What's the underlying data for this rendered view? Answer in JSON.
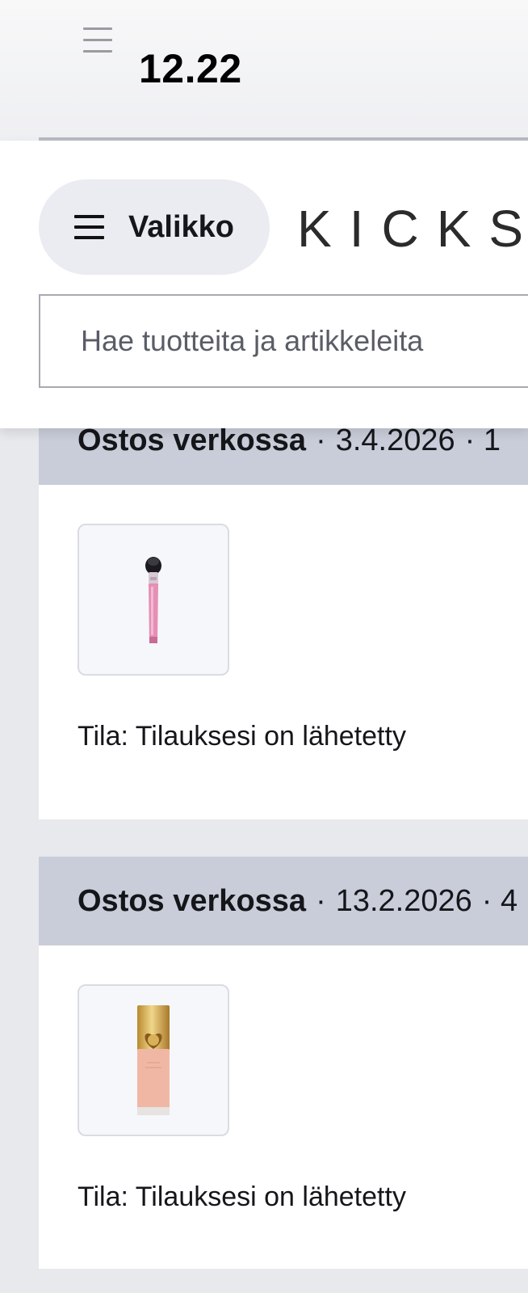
{
  "status_bar": {
    "time": "12.22",
    "menu_icon": "hamburger-icon"
  },
  "header": {
    "menu_button_label": "Valikko",
    "menu_icon": "hamburger-icon",
    "brand": "KICKS",
    "search_placeholder": "Hae tuotteita ja artikkeleita"
  },
  "orders": [
    {
      "channel": "Ostos verkossa",
      "separator": "·",
      "date": "3.4.2026",
      "date_tail": "· 1",
      "product_image": "makeup-brush",
      "status": "Tila: Tilauksesi on lähetetty"
    },
    {
      "channel": "Ostos verkossa",
      "separator": "·",
      "date": "13.2.2026",
      "date_tail": "· 4",
      "product_image": "foundation-bottle",
      "status": "Tila: Tilauksesi on lähetetty"
    }
  ],
  "colors": {
    "order_header_bg": "#c9cdd9",
    "menu_button_bg": "#ebecf2",
    "page_bg": "#e8e9ed"
  }
}
